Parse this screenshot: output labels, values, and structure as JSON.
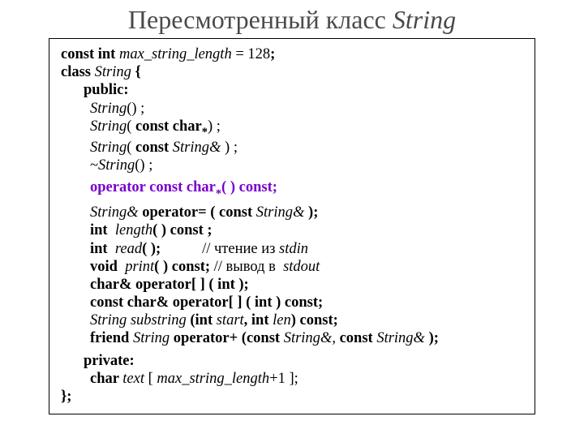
{
  "title_plain": "Пересмотренный класс ",
  "title_italic": "String",
  "code": {
    "l1": {
      "a": "const int ",
      "b": "max_string_length ",
      "c": "= 128",
      "d": ";"
    },
    "l2": {
      "a": "class ",
      "b": "String ",
      "c": "{"
    },
    "l3": "public:",
    "l4": {
      "a": "String",
      "b": "() ;"
    },
    "l5": {
      "a": "String",
      "b": "( ",
      "c": "const char",
      "star": "*",
      "d": ") ;"
    },
    "l6": {
      "a": "String",
      "b": "( ",
      "c": "const ",
      "d": "String& ",
      "e": ") ;"
    },
    "l7": {
      "a": "~",
      "b": "String",
      "c": "() ;"
    },
    "l8": {
      "a": "operator const ",
      "b": "char",
      "star": "*",
      "c": "( ) const;"
    },
    "l9": {
      "a": "String& ",
      "b": "operator= ( const ",
      "c": "String& ",
      "d": ");"
    },
    "l10": {
      "a": "int  ",
      "b": "length",
      "c": "( ) const ;"
    },
    "l11": {
      "a": "int  ",
      "b": "read",
      "c": "( );",
      "d": "           // чтение из ",
      "e": "stdin"
    },
    "l12": {
      "a": "void  ",
      "b": "print",
      "c": "( ) const;",
      "d": " // вывод в  ",
      "e": "stdout"
    },
    "l13": "char& operator[ ] ( int );",
    "l14": "const char& operator[ ] ( int ) const;",
    "l15": {
      "a": "String substring ",
      "b": "(int ",
      "c": "start",
      "d": ", int ",
      "e": "len",
      "f": ") const;"
    },
    "l16": {
      "a": "friend ",
      "b": "String ",
      "c": "operator+ (const ",
      "d": "String&, ",
      "e": "const ",
      "f": "String& ",
      "g": ");"
    },
    "l17": "private:",
    "l18": {
      "a": "char ",
      "b": "text ",
      "c": "[ ",
      "d": "max_string_length",
      "e": "+1 ];"
    },
    "l19": "};"
  }
}
